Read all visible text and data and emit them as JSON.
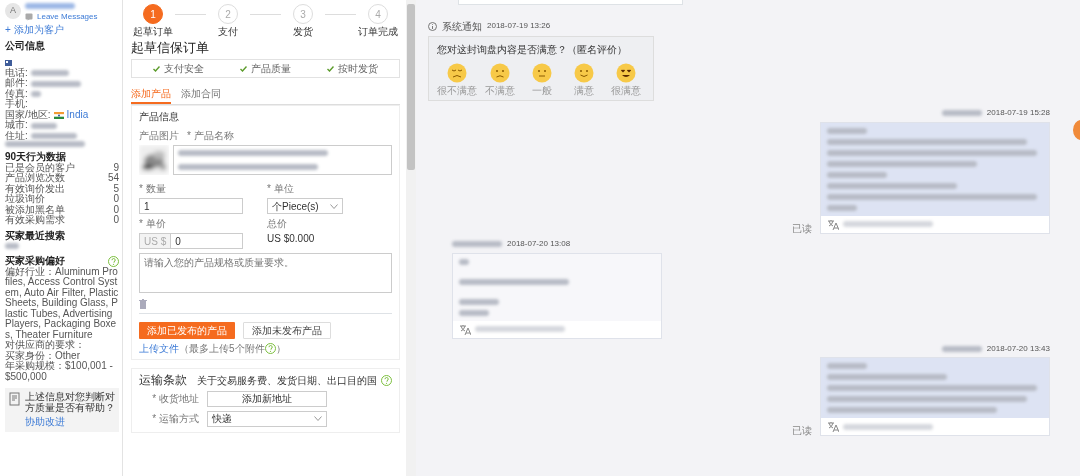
{
  "contact": {
    "avatar_letter": "A",
    "leave_messages": "Leave Messages",
    "add_customer": "+ 添加为客户"
  },
  "company": {
    "title": "公司信息",
    "fields": [
      {
        "label": "电话:"
      },
      {
        "label": "邮件:"
      },
      {
        "label": "传真:"
      },
      {
        "label": "手机:"
      },
      {
        "label": "国家/地区:",
        "value": "India"
      },
      {
        "label": "城市:"
      },
      {
        "label": "住址:"
      }
    ]
  },
  "behavior": {
    "title": "90天行为数据",
    "rows": [
      {
        "label": "已是会员的客户",
        "value": "9"
      },
      {
        "label": "产品浏览次数",
        "value": "54"
      },
      {
        "label": "有效询价发出",
        "value": "5"
      },
      {
        "label": "垃圾询价",
        "value": "0"
      },
      {
        "label": "被添加黑名单",
        "value": "0"
      },
      {
        "label": "有效采购需求",
        "value": "0"
      }
    ]
  },
  "recent_search": {
    "title": "买家最近搜索"
  },
  "preferences": {
    "title": "买家采购偏好",
    "lines": [
      "偏好行业：Aluminum Profiles, Access Control System, Auto Air Filter, Plastic Sheets, Building Glass, Plastic Tubes, Advertising Players, Packaging Boxes, Theater Furniture",
      "对供应商的要求：",
      "买家身份：Other",
      "年采购规模：$100,001 - $500,000"
    ]
  },
  "feedback": {
    "question": "上述信息对您判断对方质量是否有帮助？",
    "link": "协助改进"
  },
  "steps": [
    {
      "number": "1",
      "label": "起草订单",
      "selected": true
    },
    {
      "number": "2",
      "label": "支付",
      "selected": false
    },
    {
      "number": "3",
      "label": "发货",
      "selected": false
    },
    {
      "number": "4",
      "label": "订单完成",
      "selected": false
    }
  ],
  "order": {
    "title": "起草信保订单",
    "guarantees": [
      "支付安全",
      "产品质量",
      "按时发货"
    ],
    "tabs": [
      {
        "label": "添加产品",
        "selected": true
      },
      {
        "label": "添加合同",
        "selected": false
      }
    ],
    "product": {
      "title": "产品信息",
      "image_label": "产品图片",
      "name_label": "* 产品名称",
      "quantity_label": "* 数量",
      "quantity": "1",
      "unit_label": "* 单位",
      "unit": "个Piece(s)",
      "price_label": "* 单价",
      "currency": "US $",
      "price": "0",
      "total_label": "总价",
      "total": "US $0.000",
      "spec_placeholder": "请输入您的产品规格或质量要求。"
    },
    "buttons": [
      {
        "label": "添加已发布的产品",
        "kind": "primary"
      },
      {
        "label": "添加未发布产品",
        "kind": "secondary"
      }
    ],
    "upload": {
      "link": "上传文件",
      "note_before": "（最多上传5个附件",
      "note_after": "）"
    }
  },
  "shipping": {
    "title": "运输条款",
    "note": "关于交易服务费、发货日期、出口目的国",
    "address_label": "* 收货地址",
    "address_button": "添加新地址",
    "method_label": "* 运输方式",
    "method": "快递"
  },
  "chat": {
    "notice": {
      "label": "系统通知",
      "time": "2018-07-19 13:26",
      "question": "您对这封询盘内容是否满意？（匿名评价）",
      "options": [
        {
          "label": "很不满意",
          "kind": "very-unhappy"
        },
        {
          "label": "不满意",
          "kind": "unhappy"
        },
        {
          "label": "一般",
          "kind": "neutral"
        },
        {
          "label": "满意",
          "kind": "happy"
        },
        {
          "label": "很满意",
          "kind": "very-happy"
        }
      ]
    },
    "messages": [
      {
        "kind": "sent",
        "time": "2018-07-19 15:28",
        "read": "已读"
      },
      {
        "kind": "received",
        "time": "2018-07-20 13:08"
      },
      {
        "kind": "sent",
        "time": "2018-07-20 13:43",
        "read": "已读"
      }
    ]
  }
}
